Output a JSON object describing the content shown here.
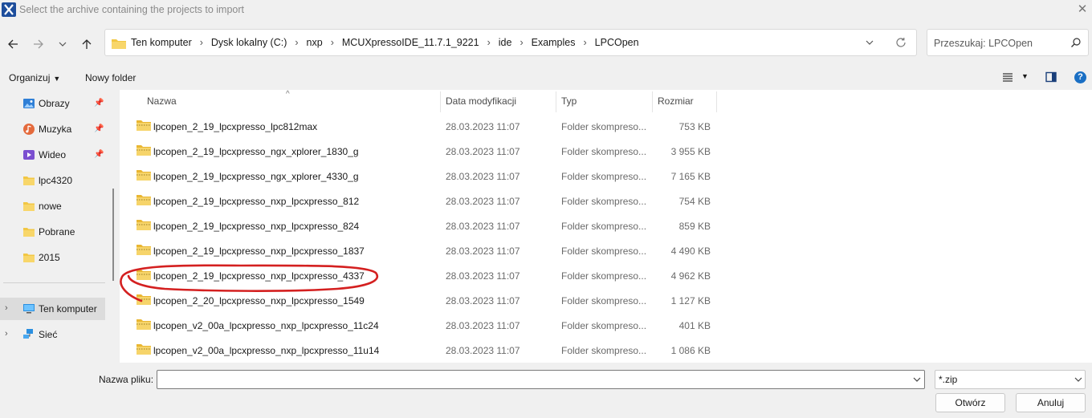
{
  "window": {
    "title": "Select the archive containing the projects to import",
    "close_glyph": "✕"
  },
  "navigation": {
    "back_icon": "arrow-left-icon",
    "forward_icon": "arrow-right-icon",
    "recent_icon": "chevron-down-icon",
    "up_icon": "arrow-up-icon",
    "breadcrumb": [
      "Ten komputer",
      "Dysk lokalny (C:)",
      "nxp",
      "MCUXpressoIDE_11.7.1_9221",
      "ide",
      "Examples",
      "LPCOpen"
    ],
    "search_placeholder": "Przeszukaj: LPCOpen"
  },
  "toolbar": {
    "organize_label": "Organizuj",
    "new_folder_label": "Nowy folder",
    "help_glyph": "?"
  },
  "sidebar": {
    "items": [
      {
        "label": "Obrazy",
        "icon": "pictures-icon",
        "pinned": true
      },
      {
        "label": "Muzyka",
        "icon": "music-icon",
        "pinned": true
      },
      {
        "label": "Wideo",
        "icon": "video-icon",
        "pinned": true
      },
      {
        "label": "lpc4320",
        "icon": "folder-icon",
        "pinned": false
      },
      {
        "label": "nowe",
        "icon": "folder-icon",
        "pinned": false
      },
      {
        "label": "Pobrane",
        "icon": "folder-icon",
        "pinned": false
      },
      {
        "label": "2015",
        "icon": "folder-icon",
        "pinned": false
      },
      {
        "label": "Ten komputer",
        "icon": "computer-icon",
        "selected": true
      },
      {
        "label": "Sieć",
        "icon": "network-icon"
      }
    ]
  },
  "columns": {
    "name": "Nazwa",
    "date": "Data modyfikacji",
    "type": "Typ",
    "size": "Rozmiar"
  },
  "files": [
    {
      "name": "lpcopen_2_19_lpcxpresso_lpc812max",
      "date": "28.03.2023 11:07",
      "type": "Folder skompreso...",
      "size": "753 KB"
    },
    {
      "name": "lpcopen_2_19_lpcxpresso_ngx_xplorer_1830_g",
      "date": "28.03.2023 11:07",
      "type": "Folder skompreso...",
      "size": "3 955 KB"
    },
    {
      "name": "lpcopen_2_19_lpcxpresso_ngx_xplorer_4330_g",
      "date": "28.03.2023 11:07",
      "type": "Folder skompreso...",
      "size": "7 165 KB"
    },
    {
      "name": "lpcopen_2_19_lpcxpresso_nxp_lpcxpresso_812",
      "date": "28.03.2023 11:07",
      "type": "Folder skompreso...",
      "size": "754 KB"
    },
    {
      "name": "lpcopen_2_19_lpcxpresso_nxp_lpcxpresso_824",
      "date": "28.03.2023 11:07",
      "type": "Folder skompreso...",
      "size": "859 KB"
    },
    {
      "name": "lpcopen_2_19_lpcxpresso_nxp_lpcxpresso_1837",
      "date": "28.03.2023 11:07",
      "type": "Folder skompreso...",
      "size": "4 490 KB"
    },
    {
      "name": "lpcopen_2_19_lpcxpresso_nxp_lpcxpresso_4337",
      "date": "28.03.2023 11:07",
      "type": "Folder skompreso...",
      "size": "4 962 KB",
      "annotated": true
    },
    {
      "name": "lpcopen_2_20_lpcxpresso_nxp_lpcxpresso_1549",
      "date": "28.03.2023 11:07",
      "type": "Folder skompreso...",
      "size": "1 127 KB"
    },
    {
      "name": "lpcopen_v2_00a_lpcxpresso_nxp_lpcxpresso_11c24",
      "date": "28.03.2023 11:07",
      "type": "Folder skompreso...",
      "size": "401 KB"
    },
    {
      "name": "lpcopen_v2_00a_lpcxpresso_nxp_lpcxpresso_11u14",
      "date": "28.03.2023 11:07",
      "type": "Folder skompreso...",
      "size": "1 086 KB"
    }
  ],
  "footer": {
    "filename_label": "Nazwa pliku:",
    "filename_value": "",
    "filter_value": "*.zip",
    "open_label": "Otwórz",
    "cancel_label": "Anuluj"
  },
  "colors": {
    "annotation_ring": "#d42020",
    "folder_yellow": "#f2c744",
    "selection_bg": "#dcdcdc",
    "help_blue": "#1a6fc4"
  }
}
